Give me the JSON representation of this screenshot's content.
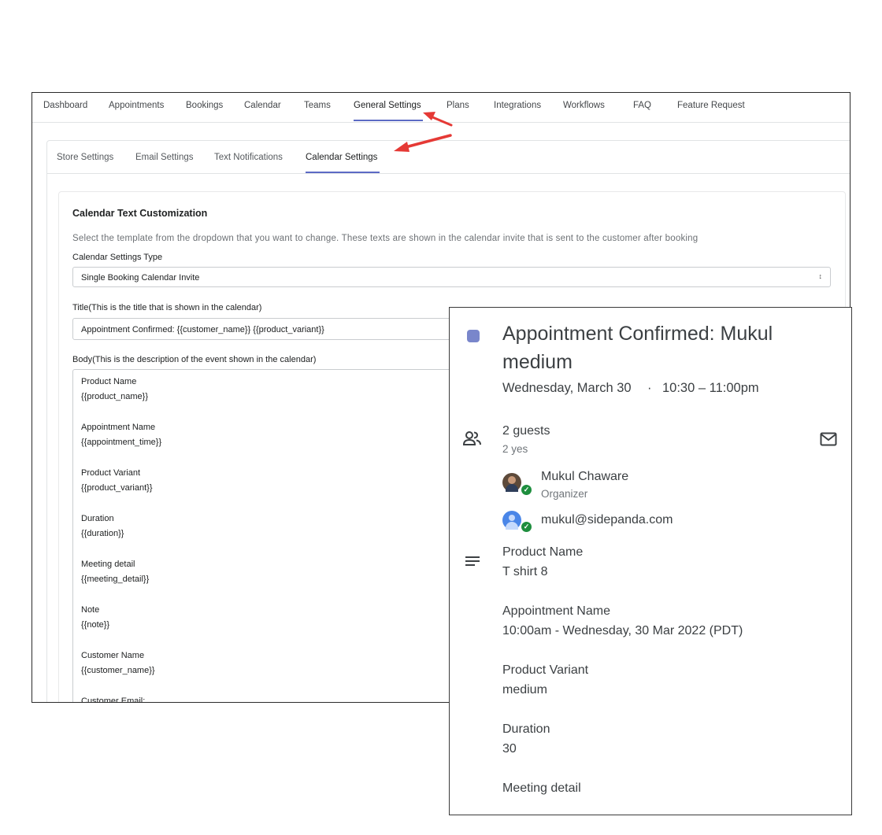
{
  "admin": {
    "top_tabs": [
      "Dashboard",
      "Appointments",
      "Bookings",
      "Calendar",
      "Teams",
      "General Settings",
      "Plans",
      "Integrations",
      "Workflows",
      "FAQ",
      "Feature Request"
    ],
    "active_top_tab": "General Settings",
    "sub_tabs": [
      "Store Settings",
      "Email Settings",
      "Text Notifications",
      "Calendar Settings"
    ],
    "active_sub_tab": "Calendar Settings",
    "section_title": "Calendar Text Customization",
    "section_description": "Select the template from the dropdown that you want to change. These texts are shown in the calendar invite that is sent to the customer after booking",
    "settings_type_label": "Calendar Settings Type",
    "settings_type_value": "Single Booking Calendar Invite",
    "title_label": "Title(This is the title that is shown in the calendar)",
    "title_value": "Appointment Confirmed: {{customer_name}} {{product_variant}}",
    "body_label": "Body(This is the description of the event shown in the calendar)",
    "body_lines": [
      "Product Name",
      "{{product_name}}",
      "Appointment Name",
      "{{appointment_time}}",
      "Product Variant",
      "{{product_variant}}",
      "Duration",
      "{{duration}}",
      "Meeting detail",
      "{{meeting_detail}}",
      "Note",
      "{{note}}",
      "Customer Name",
      "{{customer_name}}",
      "Customer Email:"
    ]
  },
  "event": {
    "color": "#7986cb",
    "title_line1": "Appointment Confirmed: Mukul",
    "title_line2": "medium",
    "date": "Wednesday, March 30",
    "separator": "·",
    "time": "10:30 – 11:00pm",
    "guests_count": "2 guests",
    "guests_yes": "2 yes",
    "organizer_name": "Mukul Chaware",
    "organizer_role": "Organizer",
    "guest_email": "mukul@sidepanda.com",
    "details": [
      {
        "label": "Product Name",
        "value": "T shirt 8"
      },
      {
        "label": "Appointment Name",
        "value": "10:00am - Wednesday, 30 Mar 2022 (PDT)"
      },
      {
        "label": "Product Variant",
        "value": "medium"
      },
      {
        "label": "Duration",
        "value": "30"
      },
      {
        "label": "Meeting detail",
        "value": ""
      }
    ]
  }
}
